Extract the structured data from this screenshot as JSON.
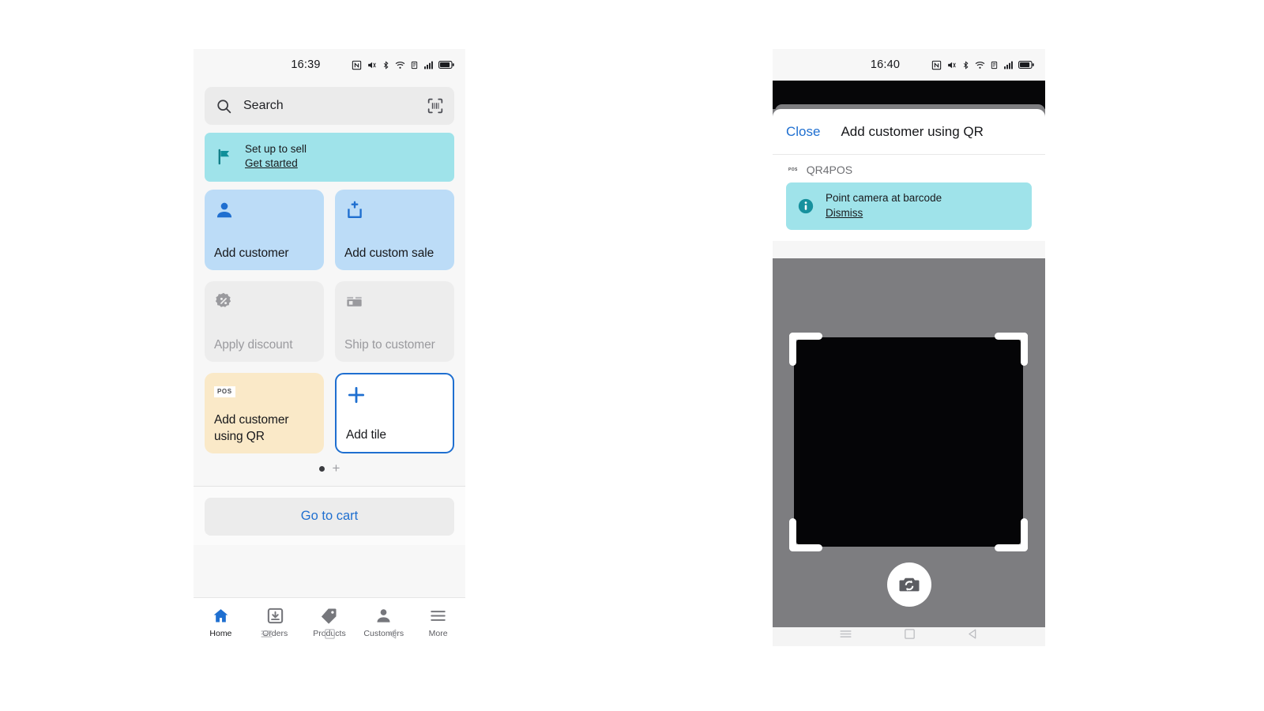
{
  "colors": {
    "accent_blue": "#1f6fd0",
    "tile_blue": "#bcdcf7",
    "tile_gray": "#ededed",
    "tile_cream": "#fae9c8",
    "banner_teal": "#9fe3ea",
    "teal_icon": "#22a0ad",
    "screen_bg": "#f7f7f7",
    "camera_gray": "#7d7d80",
    "scan_black": "#050507"
  },
  "left_phone": {
    "status_bar": {
      "time": "16:39",
      "icons": [
        "nfc-icon",
        "vibrate-icon",
        "bluetooth-icon",
        "wifi-icon",
        "signal-alt-icon",
        "cellular-bars-icon",
        "battery-icon"
      ]
    },
    "search": {
      "placeholder": "Search",
      "value": "",
      "leading_icon": "search-icon",
      "trailing_icon": "barcode-scan-icon"
    },
    "banner": {
      "icon": "flag-icon",
      "title": "Set up to sell",
      "link": "Get started"
    },
    "tiles": [
      {
        "label": "Add customer",
        "icon": "person-icon",
        "style": "blue"
      },
      {
        "label": "Add custom sale",
        "icon": "add-to-box-icon",
        "style": "blue"
      },
      {
        "label": "Apply discount",
        "icon": "discount-icon",
        "style": "gray"
      },
      {
        "label": "Ship to customer",
        "icon": "package-icon",
        "style": "gray"
      },
      {
        "label": "Add customer using QR",
        "icon": "pos-badge-icon",
        "style": "cream"
      },
      {
        "label": "Add tile",
        "icon": "plus-icon",
        "style": "outline"
      }
    ],
    "pager": {
      "dot": "●",
      "add": "+"
    },
    "cart_button": "Go to cart",
    "tabbar": [
      {
        "label": "Home",
        "icon": "home-icon",
        "active": true
      },
      {
        "label": "Orders",
        "icon": "orders-icon",
        "active": false
      },
      {
        "label": "Products",
        "icon": "tag-icon",
        "active": false
      },
      {
        "label": "Customers",
        "icon": "person-icon",
        "active": false
      },
      {
        "label": "More",
        "icon": "menu-icon",
        "active": false
      }
    ],
    "android_nav": [
      "recents-icon",
      "home-square-icon",
      "back-icon"
    ]
  },
  "right_phone": {
    "status_bar": {
      "time": "16:40",
      "icons": [
        "nfc-icon",
        "vibrate-icon",
        "bluetooth-icon",
        "wifi-icon",
        "signal-alt-icon",
        "cellular-bars-icon",
        "battery-icon"
      ]
    },
    "sheet": {
      "close_label": "Close",
      "title": "Add customer using QR",
      "app_name": "QR4POS",
      "app_icon": "pos-badge-icon",
      "info_banner": {
        "icon": "info-icon",
        "title": "Point camera at barcode",
        "link": "Dismiss"
      }
    },
    "camera": {
      "flip_button_icon": "camera-flip-icon",
      "scan_frame_corners": 4
    },
    "android_nav": [
      "recents-icon",
      "home-square-icon",
      "back-icon"
    ]
  }
}
